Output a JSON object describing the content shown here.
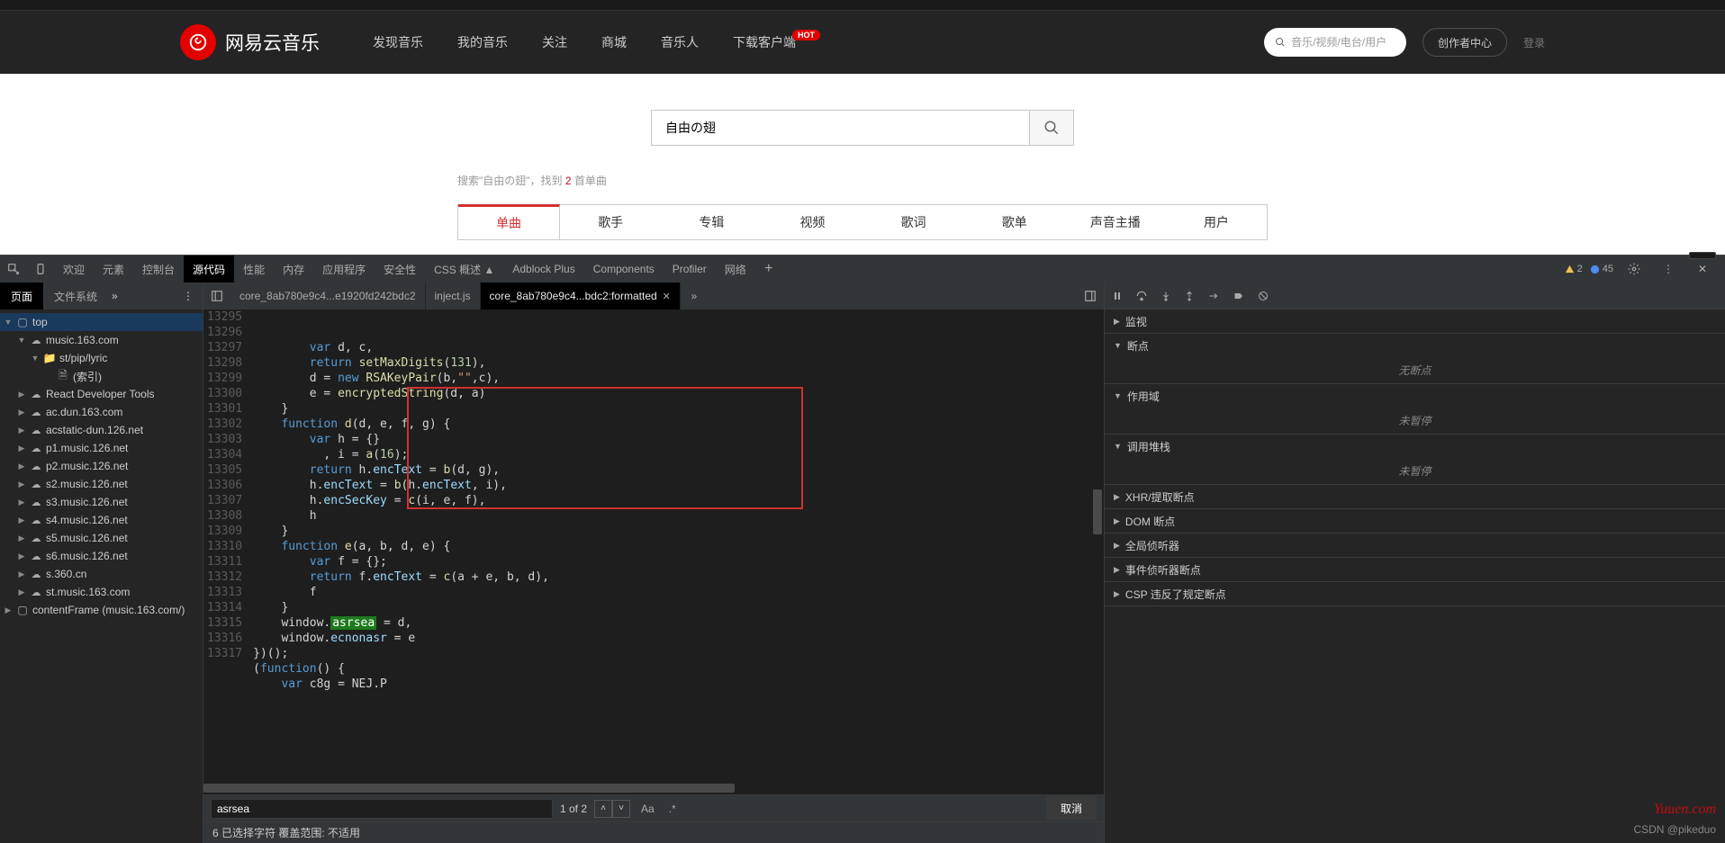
{
  "header": {
    "brand": "网易云音乐",
    "nav": [
      "发现音乐",
      "我的音乐",
      "关注",
      "商城",
      "音乐人",
      "下载客户端"
    ],
    "nav_badge": "HOT",
    "search_placeholder": "音乐/视频/电台/用户",
    "creator": "创作者中心",
    "login": "登录"
  },
  "page": {
    "search_value": "自由の翅",
    "result_prefix": "搜索\"自由の翅\"，找到 ",
    "result_count": "2",
    "result_suffix": " 首单曲",
    "tabs": [
      "单曲",
      "歌手",
      "专辑",
      "视频",
      "歌词",
      "歌单",
      "声音主播",
      "用户"
    ]
  },
  "devtools": {
    "main_tabs": [
      "欢迎",
      "元素",
      "控制台",
      "源代码",
      "性能",
      "内存",
      "应用程序",
      "安全性",
      "CSS 概述 ▲",
      "Adblock Plus",
      "Components",
      "Profiler",
      "网络"
    ],
    "active_main": "源代码",
    "warn_count": "2",
    "info_count": "45",
    "left_tabs": [
      "页面",
      "文件系统"
    ],
    "active_left": "页面",
    "tree": [
      {
        "depth": 0,
        "arrow": "down",
        "icon": "box",
        "label": "top",
        "sel": true
      },
      {
        "depth": 1,
        "arrow": "down",
        "icon": "cloud",
        "label": "music.163.com"
      },
      {
        "depth": 2,
        "arrow": "down",
        "icon": "folder",
        "label": "st/pip/lyric"
      },
      {
        "depth": 3,
        "arrow": "none",
        "icon": "file",
        "label": "(索引)"
      },
      {
        "depth": 1,
        "arrow": "right",
        "icon": "cloud",
        "label": "React Developer Tools"
      },
      {
        "depth": 1,
        "arrow": "right",
        "icon": "cloud",
        "label": "ac.dun.163.com"
      },
      {
        "depth": 1,
        "arrow": "right",
        "icon": "cloud",
        "label": "acstatic-dun.126.net"
      },
      {
        "depth": 1,
        "arrow": "right",
        "icon": "cloud",
        "label": "p1.music.126.net"
      },
      {
        "depth": 1,
        "arrow": "right",
        "icon": "cloud",
        "label": "p2.music.126.net"
      },
      {
        "depth": 1,
        "arrow": "right",
        "icon": "cloud",
        "label": "s2.music.126.net"
      },
      {
        "depth": 1,
        "arrow": "right",
        "icon": "cloud",
        "label": "s3.music.126.net"
      },
      {
        "depth": 1,
        "arrow": "right",
        "icon": "cloud",
        "label": "s4.music.126.net"
      },
      {
        "depth": 1,
        "arrow": "right",
        "icon": "cloud",
        "label": "s5.music.126.net"
      },
      {
        "depth": 1,
        "arrow": "right",
        "icon": "cloud",
        "label": "s6.music.126.net"
      },
      {
        "depth": 1,
        "arrow": "right",
        "icon": "cloud",
        "label": "s.360.cn"
      },
      {
        "depth": 1,
        "arrow": "right",
        "icon": "cloud",
        "label": "st.music.163.com"
      },
      {
        "depth": 0,
        "arrow": "right",
        "icon": "box",
        "label": "contentFrame (music.163.com/)"
      }
    ],
    "file_tabs": [
      {
        "label": "core_8ab780e9c4...e1920fd242bdc2",
        "active": false
      },
      {
        "label": "inject.js",
        "active": false
      },
      {
        "label": "core_8ab780e9c4...bdc2:formatted",
        "active": true
      }
    ],
    "code_start_line": 13295,
    "code_lines": [
      [
        [
          "        "
        ],
        [
          "var",
          "kw"
        ],
        [
          " d, c,"
        ]
      ],
      [
        [
          "        "
        ],
        [
          "return",
          "kw"
        ],
        [
          " "
        ],
        [
          "setMaxDigits",
          "fn"
        ],
        [
          "("
        ],
        [
          "131",
          "num"
        ],
        [
          "),"
        ]
      ],
      [
        [
          "        d = "
        ],
        [
          "new",
          "kw"
        ],
        [
          " "
        ],
        [
          "RSAKeyPair",
          "fn"
        ],
        [
          "(b,"
        ],
        [
          "\"\"",
          "str"
        ],
        [
          ",c),"
        ]
      ],
      [
        [
          "        e = "
        ],
        [
          "encryptedString",
          "fn"
        ],
        [
          "(d, a)"
        ]
      ],
      [
        [
          "    }"
        ]
      ],
      [
        [
          "    "
        ],
        [
          "function",
          "kw"
        ],
        [
          " "
        ],
        [
          "d",
          "fn"
        ],
        [
          "(d, e, f, g) {"
        ]
      ],
      [
        [
          "        "
        ],
        [
          "var",
          "kw"
        ],
        [
          " h = {}"
        ]
      ],
      [
        [
          "          , i = "
        ],
        [
          "a",
          "fn"
        ],
        [
          "("
        ],
        [
          "16",
          "num"
        ],
        [
          ");"
        ]
      ],
      [
        [
          "        "
        ],
        [
          "return",
          "kw"
        ],
        [
          " h."
        ],
        [
          "encText",
          "prop"
        ],
        [
          " = "
        ],
        [
          "b",
          "fn"
        ],
        [
          "(d, g),"
        ]
      ],
      [
        [
          "        h."
        ],
        [
          "encText",
          "prop"
        ],
        [
          " = "
        ],
        [
          "b",
          "fn"
        ],
        [
          "(h."
        ],
        [
          "encText",
          "prop"
        ],
        [
          ", i),"
        ]
      ],
      [
        [
          "        h."
        ],
        [
          "encSecKey",
          "prop"
        ],
        [
          " = "
        ],
        [
          "c",
          "fn"
        ],
        [
          "(i, e, f),"
        ]
      ],
      [
        [
          "        h"
        ]
      ],
      [
        [
          "    }"
        ]
      ],
      [
        [
          "    "
        ],
        [
          "function",
          "kw"
        ],
        [
          " "
        ],
        [
          "e",
          "fn"
        ],
        [
          "(a, b, d, e) {"
        ]
      ],
      [
        [
          "        "
        ],
        [
          "var",
          "kw"
        ],
        [
          " f = {};"
        ]
      ],
      [
        [
          "        "
        ],
        [
          "return",
          "kw"
        ],
        [
          " f."
        ],
        [
          "encText",
          "prop"
        ],
        [
          " = "
        ],
        [
          "c",
          "fn"
        ],
        [
          "(a + e, b, d),"
        ]
      ],
      [
        [
          "        f"
        ]
      ],
      [
        [
          "    }"
        ]
      ],
      [
        [
          "    window."
        ],
        [
          "asrsea",
          "hl-green"
        ],
        [
          " = d,"
        ]
      ],
      [
        [
          "    window."
        ],
        [
          "ecnonasr",
          "prop"
        ],
        [
          " = e"
        ]
      ],
      [
        [
          "}"
        ],
        [
          ")();"
        ]
      ],
      [
        [
          "("
        ],
        [
          "function",
          "kw"
        ],
        [
          "() {"
        ]
      ],
      [
        [
          "    "
        ],
        [
          "var",
          "kw"
        ],
        [
          " c8g = NEJ.P"
        ]
      ]
    ],
    "search": {
      "value": "asrsea",
      "count": "1 of 2",
      "cancel": "取消",
      "aa": "Aa",
      "regex": ".*"
    },
    "status": "6 已选择字符   覆盖范围: 不适用",
    "debugger": {
      "panels": [
        {
          "title": "监视",
          "arrow": "▶"
        },
        {
          "title": "断点",
          "arrow": "▼",
          "body": "无断点"
        },
        {
          "title": "作用域",
          "arrow": "▼",
          "body": "未暂停"
        },
        {
          "title": "调用堆栈",
          "arrow": "▼",
          "body": "未暂停"
        },
        {
          "title": "XHR/提取断点",
          "arrow": "▶"
        },
        {
          "title": "DOM 断点",
          "arrow": "▶"
        },
        {
          "title": "全局侦听器",
          "arrow": "▶"
        },
        {
          "title": "事件侦听器断点",
          "arrow": "▶"
        },
        {
          "title": "CSP 违反了规定断点",
          "arrow": "▶"
        }
      ]
    }
  },
  "watermark": {
    "yuuen": "Yuuen.com",
    "csdn": "CSDN @pikeduo"
  }
}
